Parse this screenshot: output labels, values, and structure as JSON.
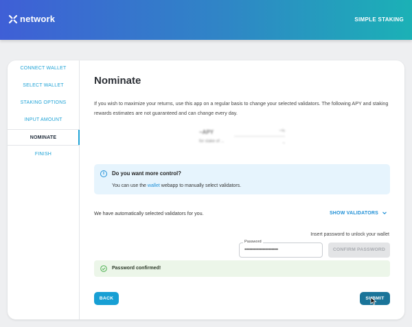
{
  "brand": {
    "name": "network",
    "app_title": "SIMPLE STAKING"
  },
  "steps": [
    {
      "label": "CONNECT WALLET",
      "active": false
    },
    {
      "label": "SELECT WALLET",
      "active": false
    },
    {
      "label": "STAKING OPTIONS",
      "active": false
    },
    {
      "label": "INPUT AMOUNT",
      "active": false
    },
    {
      "label": "NOMINATE",
      "active": true
    },
    {
      "label": "FINISH",
      "active": false
    }
  ],
  "page": {
    "title": "Nominate",
    "intro": "If you wish to maximize your returns, use this app on a regular basis to change your selected validators. The following APY and staking rewards estimates are not guaranteed and can change every day."
  },
  "info": {
    "title": "Do you want more control?",
    "text_before": "You can use the ",
    "link": "wallet",
    "text_after": " webapp to manually select validators."
  },
  "validators": {
    "auto_text": "We have automatically selected validators for you.",
    "show_label": "SHOW VALIDATORS"
  },
  "password": {
    "unlock_text": "Insert password to unlock your wallet",
    "label": "Password",
    "value": "••••••••••••••••••••••••••",
    "confirm_label": "CONFIRM PASSWORD",
    "confirmed_text": "Password confirmed!"
  },
  "actions": {
    "back": "BACK",
    "submit": "SUBMIT"
  },
  "colors": {
    "accent": "#1ea2d6",
    "submit": "#1a7499",
    "success_bg": "#ecf6e9",
    "info_bg": "#e6f4fd"
  }
}
